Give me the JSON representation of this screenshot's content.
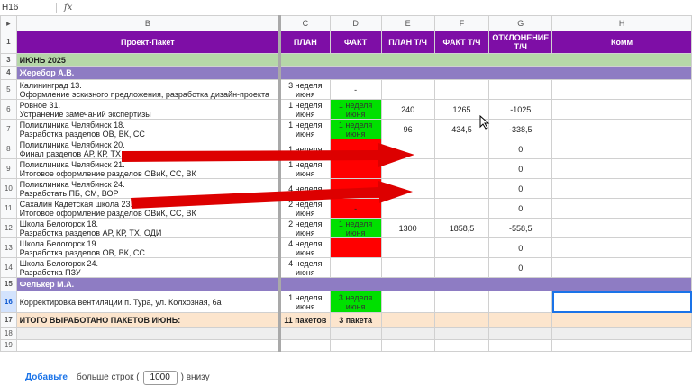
{
  "formula_bar": {
    "name_box": "H16",
    "fx": "fx"
  },
  "columns": [
    "",
    "B",
    "C",
    "D",
    "E",
    "F",
    "G",
    "H"
  ],
  "header": {
    "project": "Проект-Пакет",
    "plan": "ПЛАН",
    "fact": "ФАКТ",
    "plan_hours": "ПЛАН Т/Ч",
    "fact_hours": "ФАКТ Т/Ч",
    "deviation": "ОТКЛОНЕНИЕ Т/Ч",
    "comment": "Комм"
  },
  "rows": {
    "r3": {
      "num": "3",
      "label": "ИЮНЬ 2025"
    },
    "r4": {
      "num": "4",
      "label": "Жеребор А.В."
    },
    "r5": {
      "num": "5",
      "line1": "Калининград 13.",
      "line2": "Оформление эскизного предложения, разработка дизайн-проекта",
      "plan": "3 неделя июня",
      "fact": "-",
      "ph": "",
      "fh": "",
      "dev": ""
    },
    "r6": {
      "num": "6",
      "line1": "Ровное 31.",
      "line2": "Устранение замечаний экспертизы",
      "plan": "1 неделя июня",
      "fact": "1 неделя июня",
      "ph": "240",
      "fh": "1265",
      "dev": "-1025"
    },
    "r7": {
      "num": "7",
      "line1": "Поликлиника Челябинск 18.",
      "line2": "Разработка разделов ОВ, ВК, СС",
      "plan": "1 неделя июня",
      "fact": "1 неделя июня",
      "ph": "96",
      "fh": "434,5",
      "dev": "-338,5"
    },
    "r8": {
      "num": "8",
      "line1": "Поликлиника Челябинск 20.",
      "line2": "Финал разделов АР, КР, ТХ",
      "plan": "1 неделя",
      "fact": "",
      "ph": "",
      "fh": "",
      "dev": "0"
    },
    "r9": {
      "num": "9",
      "line1": "Поликлиника Челябинск 21.",
      "line2": "Итоговое оформление разделов ОВиК, СС, ВК",
      "plan": "1 неделя июня",
      "fact": "",
      "ph": "",
      "fh": "",
      "dev": "0"
    },
    "r10": {
      "num": "10",
      "line1": "Поликлиника Челябинск 24.",
      "line2": "Разработать ПБ, СМ, ВОР",
      "plan": "4 неделя",
      "fact": "",
      "ph": "",
      "fh": "",
      "dev": "0"
    },
    "r11": {
      "num": "11",
      "line1": "Сахалин Кадетская школа  23.",
      "line2": "Итоговое оформление разделов ОВиК, СС, ВК",
      "plan": "2 неделя июня",
      "fact": "-",
      "ph": "",
      "fh": "",
      "dev": "0"
    },
    "r12": {
      "num": "12",
      "line1": "Школа Белогорск 18.",
      "line2": "Разработка разделов АР, КР, ТХ, ОДИ",
      "plan": "2 неделя июня",
      "fact": "1 неделя июня",
      "ph": "1300",
      "fh": "1858,5",
      "dev": "-558,5"
    },
    "r13": {
      "num": "13",
      "line1": "Школа Белогорск 19.",
      "line2": "Разработка разделов ОВ, ВК, СС",
      "plan": "4 неделя июня",
      "fact": "",
      "ph": "",
      "fh": "",
      "dev": "0"
    },
    "r14": {
      "num": "14",
      "line1": "Школа Белогорск 24.",
      "line2": "Разработка ПЗУ",
      "plan": "4 неделя июня",
      "fact": "",
      "ph": "",
      "fh": "",
      "dev": "0"
    },
    "r15": {
      "num": "15",
      "label": "Фелькер М.А."
    },
    "r16": {
      "num": "16",
      "line1": "Корректировка вентиляции п. Тура, ул. Колхозная, 6а",
      "plan": "1 неделя июня",
      "fact": "3 неделя июня",
      "ph": "",
      "fh": "",
      "dev": ""
    },
    "r17": {
      "num": "17",
      "label": "ИТОГО ВЫРАБОТАНО ПАКЕТОВ ИЮНЬ:",
      "plan": "11 пакетов",
      "fact": "3 пакета"
    },
    "r18": {
      "num": "18"
    },
    "r19": {
      "num": "19"
    }
  },
  "header_row_num": "1",
  "bottom_bar": {
    "add": "Добавьте",
    "more": "больше строк (",
    "count": "1000",
    "below": ") внизу"
  },
  "colors": {
    "header": "#7e0ea6",
    "month": "#b6d7a8",
    "person": "#8e7cc3",
    "total": "#fce5cd",
    "green": "#00e000",
    "red": "#ff0000",
    "arrow": "#dd0000"
  },
  "icons": [
    "red-arrow-annotation",
    "mouse-cursor-icon"
  ]
}
